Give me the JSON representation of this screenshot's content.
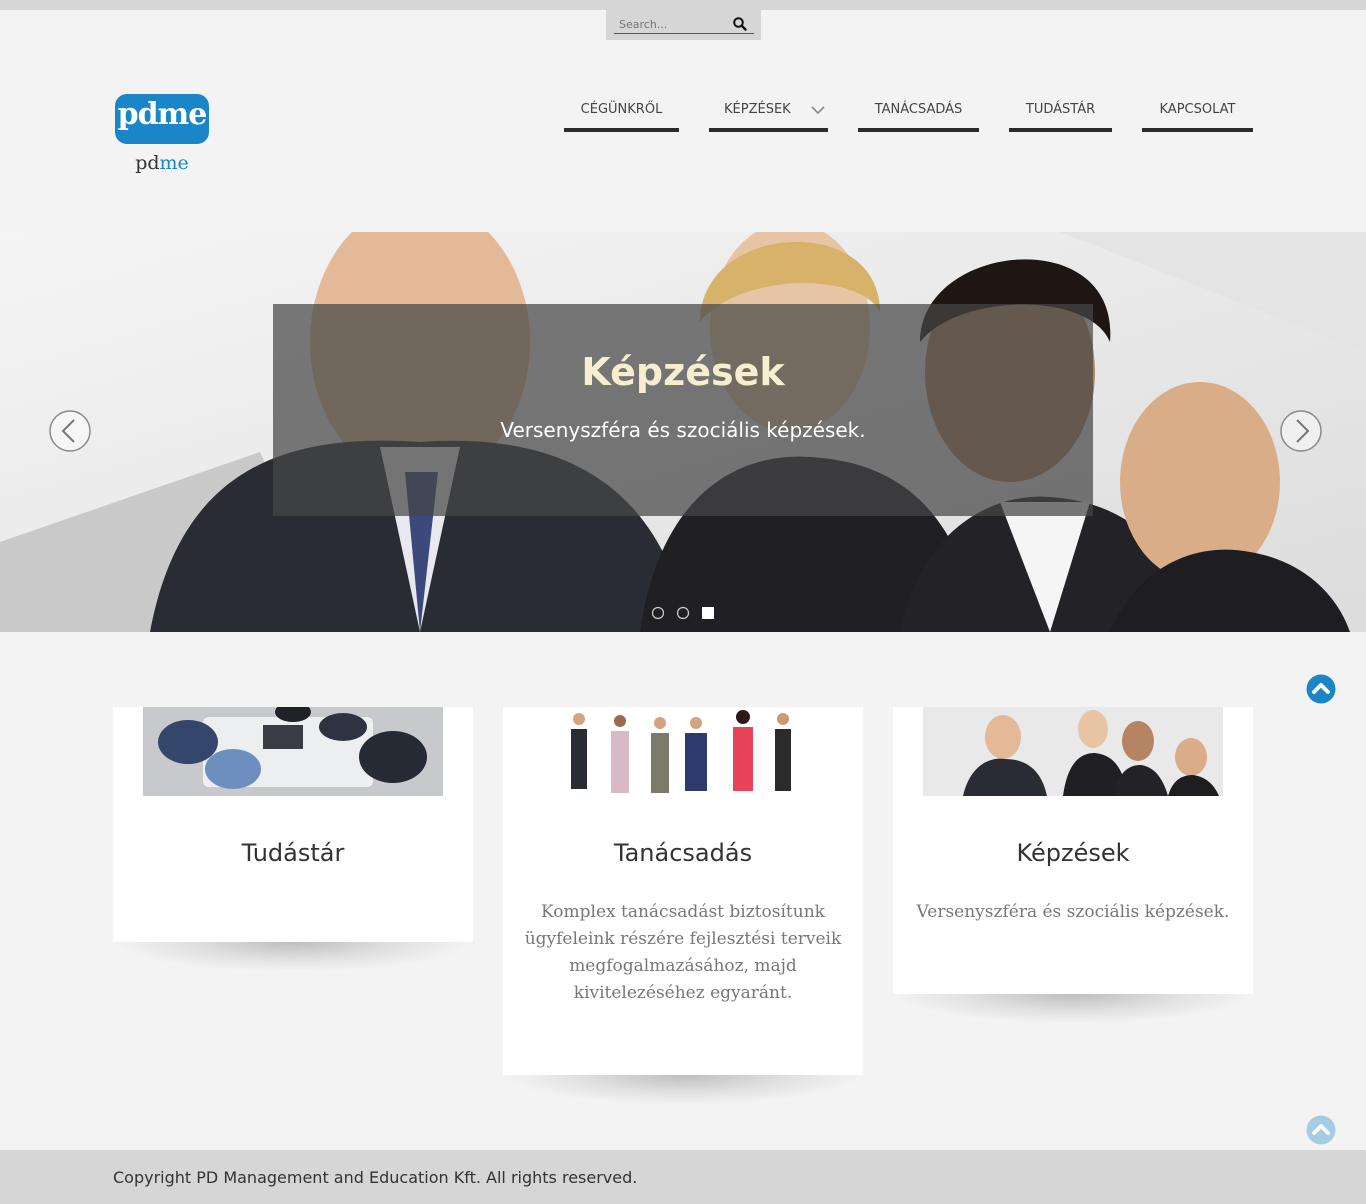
{
  "search": {
    "placeholder": "Search..."
  },
  "logo": {
    "badge": "pdme",
    "sub_pd": "pd",
    "sub_me": "me"
  },
  "nav": [
    {
      "label": "CÉGÜNKRŐL"
    },
    {
      "label": "KÉPZÉSEK",
      "has_dropdown": true
    },
    {
      "label": "TANÁCSADÁS"
    },
    {
      "label": "TUDÁSTÁR"
    },
    {
      "label": "KAPCSOLAT"
    }
  ],
  "slider": {
    "title": "Képzések",
    "text": "Versenyszféra és szociális képzések.",
    "dots_count": 3,
    "active_dot": 3
  },
  "cards": [
    {
      "title": "Tudástár",
      "text": ""
    },
    {
      "title": "Tanácsadás",
      "text": "Komplex tanácsadást biztosítunk ügyfeleink részére fejlesztési terveik megfogalmazásához, majd kivitelezéséhez egyaránt."
    },
    {
      "title": "Képzések",
      "text": "Versenyszféra és szociális képzések."
    }
  ],
  "footer": {
    "copyright": "Copyright PD Management and Education Kft. All rights reserved."
  },
  "colors": {
    "accent": "#1a86c8",
    "nav_border": "#2b2b2b",
    "background": "#f3f3f3",
    "footer": "#d6d6d6"
  },
  "icons": {
    "search": "search-icon",
    "prev": "chevron-left-icon",
    "next": "chevron-right-icon",
    "top": "chevron-up-icon"
  }
}
